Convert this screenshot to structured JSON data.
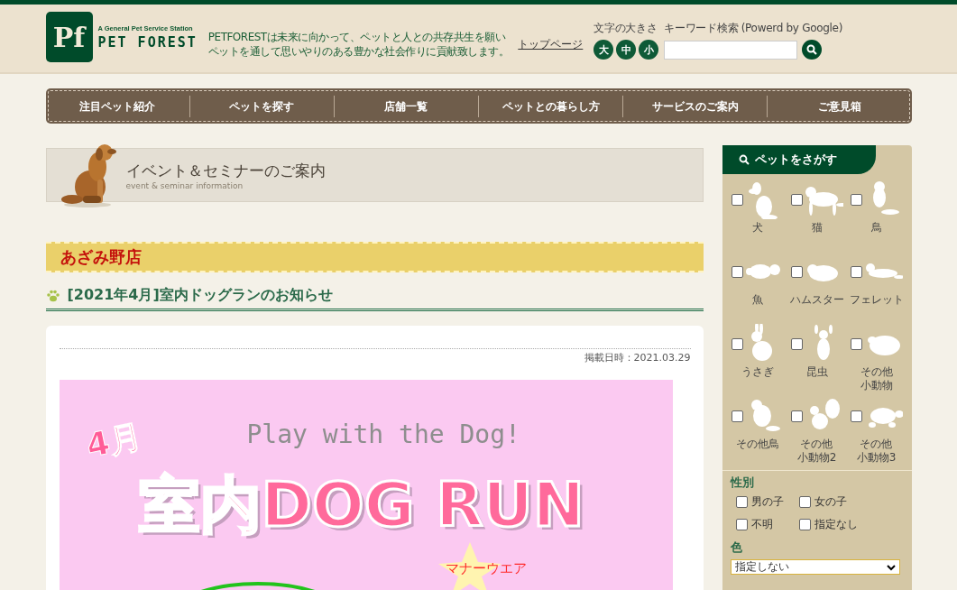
{
  "header": {
    "logo_mark": "Pf",
    "logo_tagline": "A General Pet Service Station",
    "logo_name": "PET FOREST",
    "mission_lines": [
      "PETFORESTは未来に向かって、ペットと人との共存共生を願い",
      "ペットを通して思いやりのある豊かな社会作りに貢献致します。"
    ],
    "top_link": "トップページ",
    "font_size_label": "文字の大きさ",
    "font_sizes": [
      "大",
      "中",
      "小"
    ],
    "search_label": "キーワード検索 (Powerd by Google)"
  },
  "nav": [
    "注目ペット紹介",
    "ペットを探す",
    "店舗一覧",
    "ペットとの暮らし方",
    "サービスのご案内",
    "ご意見箱"
  ],
  "banner": {
    "title": "イベント＆セミナーのご案内",
    "subtitle": "event & seminar information"
  },
  "store": "あざみ野店",
  "article": {
    "title": "[2021年4月]室内ドッグランのお知らせ",
    "posted": "掲載日時：2021.03.29",
    "flyer": {
      "month": "4月",
      "tagline": "Play with the Dog!",
      "headline": "室内DOG RUN",
      "note": "マナーウエア"
    }
  },
  "sidebar": {
    "heading": "ペットをさがす",
    "pets": [
      {
        "kind": "dog",
        "lines": [
          "犬"
        ],
        "checked": false
      },
      {
        "kind": "cat",
        "lines": [
          "猫"
        ],
        "checked": false
      },
      {
        "kind": "parakeet",
        "lines": [
          "鳥"
        ],
        "checked": false
      },
      {
        "kind": "fish",
        "lines": [
          "魚"
        ],
        "checked": false
      },
      {
        "kind": "hamster",
        "lines": [
          "ハムスター"
        ],
        "checked": false
      },
      {
        "kind": "ferret",
        "lines": [
          "フェレット"
        ],
        "checked": false
      },
      {
        "kind": "rabbit",
        "lines": [
          "うさぎ"
        ],
        "checked": false
      },
      {
        "kind": "beetle",
        "lines": [
          "昆虫"
        ],
        "checked": false
      },
      {
        "kind": "guinea",
        "lines": [
          "その他",
          "小動物"
        ],
        "checked": false
      },
      {
        "kind": "finch",
        "lines": [
          "その他鳥"
        ],
        "checked": false
      },
      {
        "kind": "squirrel",
        "lines": [
          "その他",
          "小動物2"
        ],
        "checked": false
      },
      {
        "kind": "turtle",
        "lines": [
          "その他",
          "小動物3"
        ],
        "checked": false
      }
    ],
    "gender_label": "性別",
    "genders": [
      {
        "label": "男の子",
        "checked": false
      },
      {
        "label": "女の子",
        "checked": false
      },
      {
        "label": "不明",
        "checked": false
      },
      {
        "label": "指定なし",
        "checked": false
      }
    ],
    "color_label": "色",
    "color_select": "指定しない"
  }
}
